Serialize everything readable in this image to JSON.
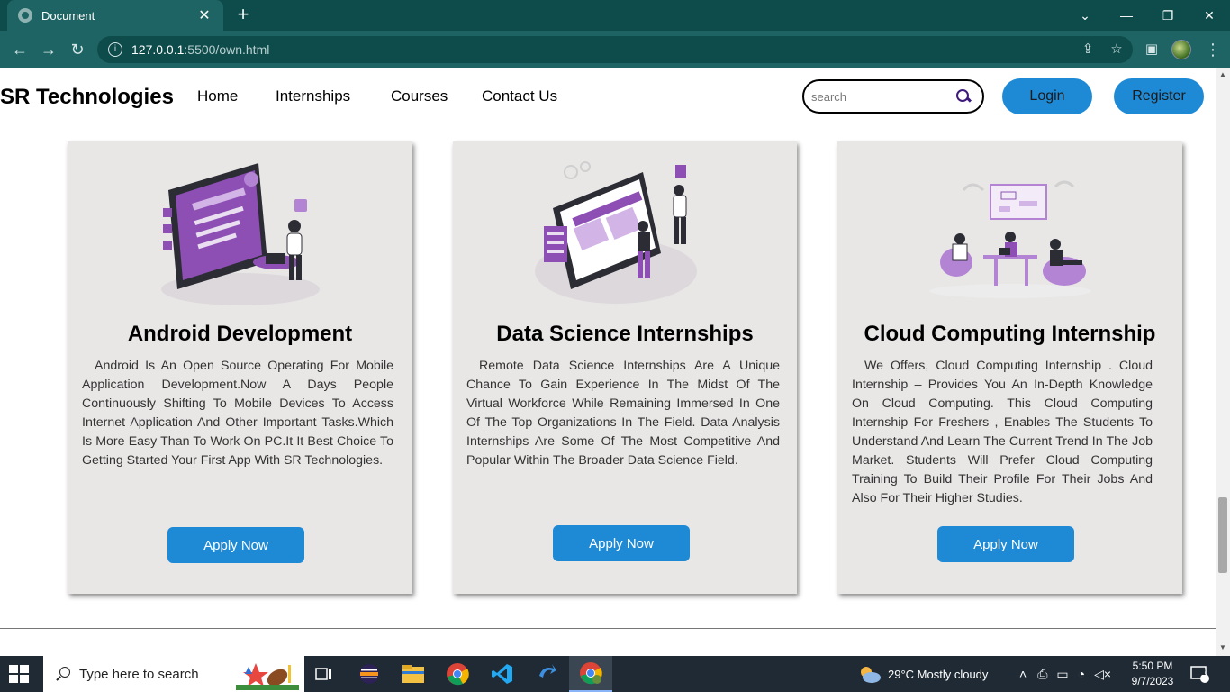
{
  "browser": {
    "tab_title": "Document",
    "tab_close": "✕",
    "new_tab": "+",
    "url_host": "127.0.0.1",
    "url_path": ":5500/own.html",
    "info_icon": "i",
    "window_controls": {
      "minimize": "—",
      "restore": "❐",
      "close": "✕",
      "dropdown": "⌄"
    }
  },
  "site": {
    "brand": "SR Technologies",
    "nav": [
      "Home",
      "Internships",
      "Courses",
      "Contact Us"
    ],
    "search_placeholder": "search",
    "login": "Login",
    "register": "Register"
  },
  "cards": [
    {
      "title": "Android Development",
      "description": "Android Is An Open Source Operating For Mobile Application Development.Now A Days People Continuously Shifting To Mobile Devices To Access Internet Application And Other Important Tasks.Which Is More Easy Than To Work On PC.It It Best Choice To Getting Started Your First App With SR Technologies.",
      "button": "Apply Now"
    },
    {
      "title": "Data Science Internships",
      "description": "Remote Data Science Internships Are A Unique Chance To Gain Experience In The Midst Of The Virtual Workforce While Remaining Immersed In One Of The Top Organizations In The Field. Data Analysis Internships Are Some Of The Most Competitive And Popular Within The Broader Data Science Field.",
      "button": "Apply Now"
    },
    {
      "title": "Cloud Computing Internship",
      "description": "We Offers, Cloud Computing Internship . Cloud Internship – Provides You An In-Depth Knowledge On Cloud Computing. This Cloud Computing Internship For Freshers , Enables The Students To Understand And Learn The Current Trend In The Job Market. Students Will Prefer Cloud Computing Training To Build Their Profile For Their Jobs And Also For Their Higher Studies.",
      "button": "Apply Now"
    }
  ],
  "taskbar": {
    "search_placeholder": "Type here to search",
    "weather": "29°C  Mostly cloudy",
    "time": "5:50 PM",
    "date": "9/7/2023",
    "notification_count": "2"
  },
  "colors": {
    "accent": "#1e8ad6",
    "card_bg": "#e9e7e6",
    "chrome_dark": "#0e4b4b",
    "chrome_toolbar": "#1f6464",
    "illustration_purple": "#8e4fb5"
  },
  "icons": {
    "back": "arrow-left-icon",
    "forward": "arrow-right-icon",
    "reload": "reload-icon",
    "share": "share-icon",
    "bookmark": "star-icon",
    "sidepanel": "side-panel-icon",
    "menu": "kebab-menu-icon",
    "search": "search-icon"
  }
}
